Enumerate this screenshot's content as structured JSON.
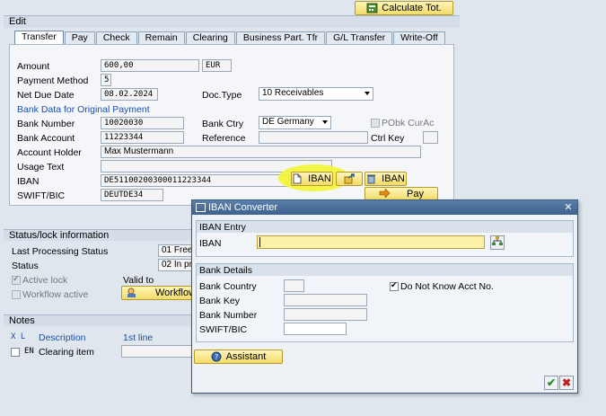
{
  "toolbar": {
    "calculate_label": "Calculate Tot."
  },
  "edit": {
    "title": "Edit",
    "tabs": [
      "Transfer",
      "Pay",
      "Check",
      "Remain",
      "Clearing",
      "Business Part. Tfr",
      "G/L Transfer",
      "Write-Off"
    ],
    "amount_label": "Amount",
    "amount_value": "600,00",
    "currency": "EUR",
    "payment_method_label": "Payment Method",
    "payment_method_value": "5",
    "net_due_label": "Net Due Date",
    "net_due_value": "08.02.2024",
    "doctype_label": "Doc.Type",
    "doctype_value": "10 Receivables",
    "bank_section_label": "Bank Data for Original Payment",
    "bank_number_label": "Bank Number",
    "bank_number_value": "10020030",
    "bank_ctry_label": "Bank Ctry",
    "bank_ctry_value": "DE Germany",
    "pobk_label": "PObk CurAc",
    "bank_account_label": "Bank Account",
    "bank_account_value": "11223344",
    "reference_label": "Reference",
    "ctrl_key_label": "Ctrl Key",
    "account_holder_label": "Account Holder",
    "account_holder_value": "Max Mustermann",
    "usage_text_label": "Usage Text",
    "iban_label": "IBAN",
    "iban_value": "DE51100200300011223344",
    "iban_button": "IBAN",
    "iban_delete_button": "IBAN",
    "swift_label": "SWIFT/BIC",
    "swift_value": "DEUTDE34",
    "pay_button": "Pay"
  },
  "status": {
    "title": "Status/lock information",
    "last_processing_label": "Last Processing Status",
    "last_processing_value": "01 Free",
    "status_label": "Status",
    "status_value": "02 In pr",
    "active_lock_label": "Active lock",
    "workflow_active_label": "Workflow active",
    "valid_to_label": "Valid to",
    "workflow_button": "Workflow"
  },
  "notes": {
    "title": "Notes",
    "col_icon": "X L",
    "col_description": "Description",
    "col_first_line": "1st line",
    "row_lang": "EN",
    "row_desc": "Clearing item"
  },
  "dialog": {
    "title": "IBAN Converter",
    "iban_entry_title": "IBAN Entry",
    "iban_label": "IBAN",
    "iban_value": "",
    "bank_details_title": "Bank Details",
    "bank_country_label": "Bank Country",
    "bank_key_label": "Bank Key",
    "bank_number_label": "Bank Number",
    "swift_label": "SWIFT/BIC",
    "dont_know_label": "Do Not Know Acct No.",
    "assistant_button": "Assistant"
  }
}
